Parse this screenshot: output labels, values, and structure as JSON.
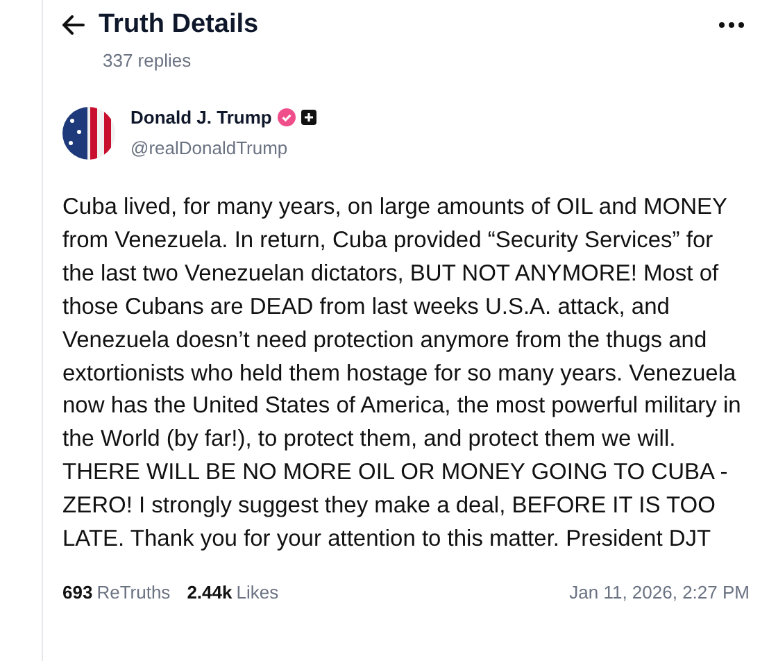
{
  "header": {
    "title": "Truth Details",
    "subtitle": "337 replies"
  },
  "author": {
    "name": "Donald J. Trump",
    "verified": true,
    "handle": "@realDonaldTrump"
  },
  "post": {
    "text": "Cuba lived, for many years, on large amounts of OIL and MONEY from Venezuela. In return, Cuba provided “Security Services” for the last two Venezuelan dictators, BUT NOT ANYMORE! Most of those Cubans are DEAD from last weeks U.S.A. attack, and Venezuela doesn’t need protection anymore from the thugs and extortionists who held them hostage for so many years. Venezuela now has the United States of America, the most powerful military in the World (by far!), to protect them, and protect them we will. THERE WILL BE NO MORE OIL OR MONEY GOING TO CUBA - ZERO! I strongly suggest they make a deal, BEFORE IT IS TOO LATE. Thank you for your attention to this matter. President DJT"
  },
  "stats": [
    {
      "count": "693",
      "label": "ReTruths"
    },
    {
      "count": "2.44k",
      "label": "Likes"
    }
  ],
  "timestamp": "Jan 11, 2026, 2:27 PM"
}
